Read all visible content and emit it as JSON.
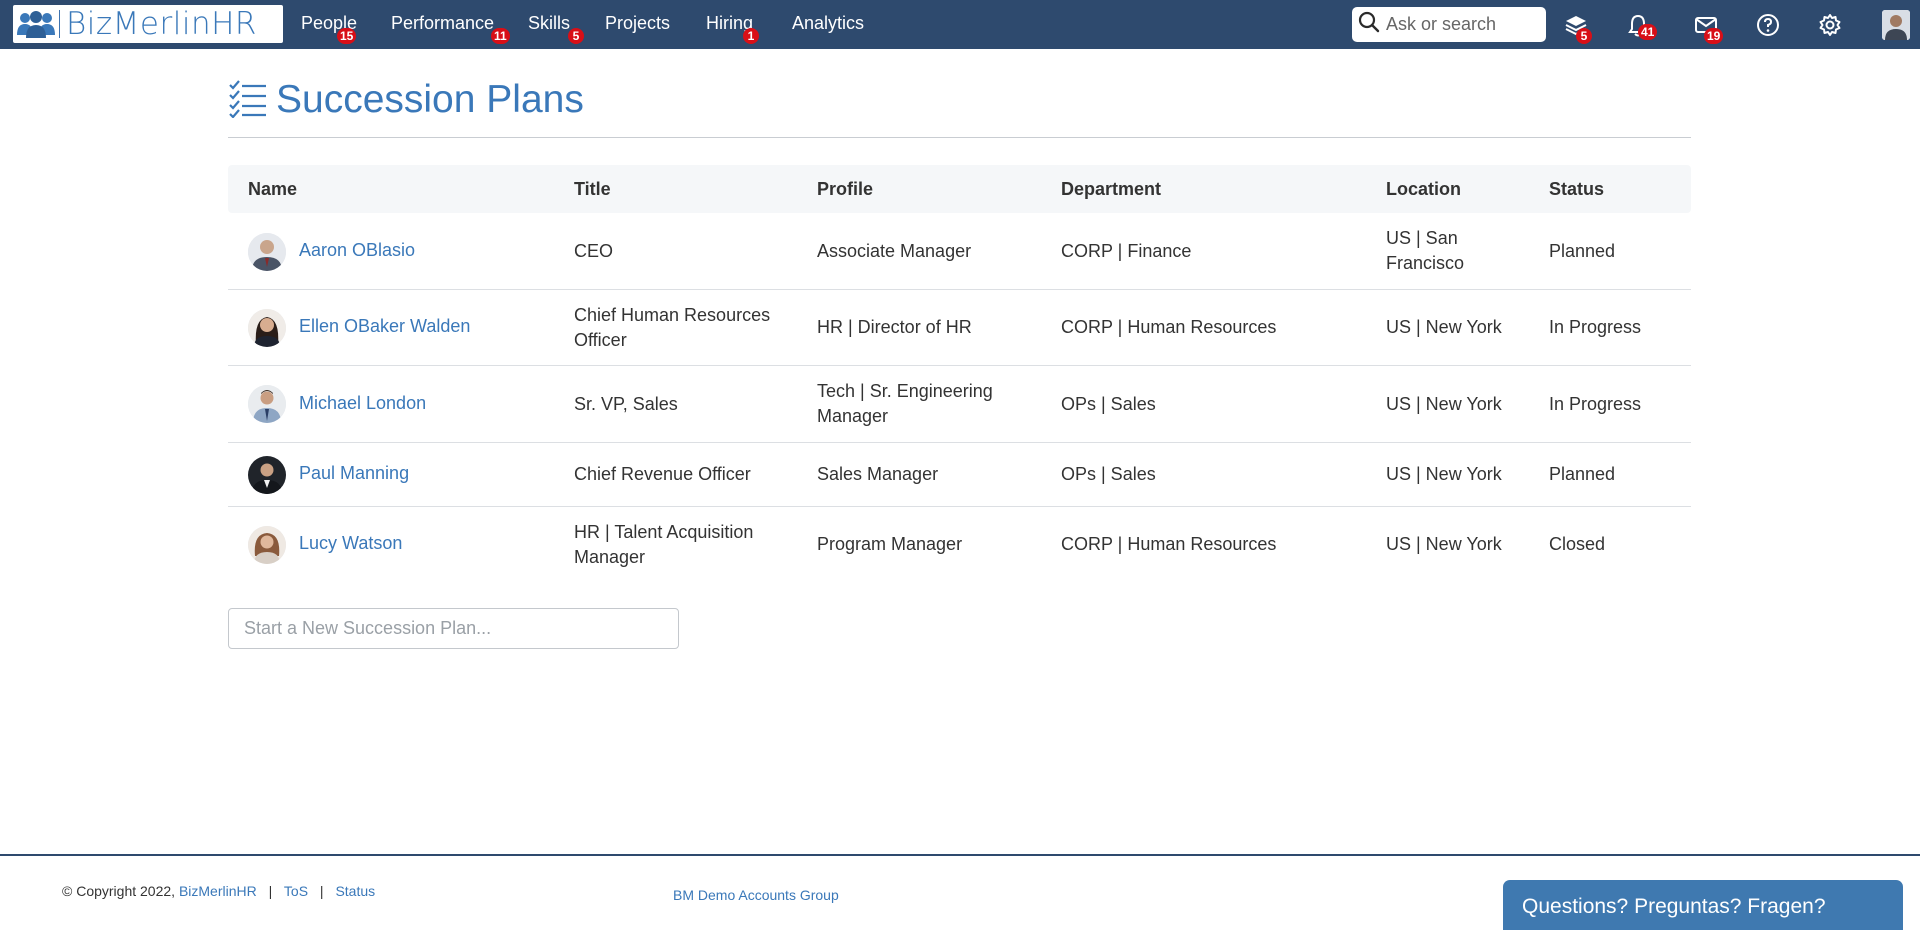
{
  "app": {
    "logo_text": "BizMerlinHR",
    "accent": "#3a78b9",
    "nav_bg": "#2e4a6e",
    "badge_color": "#d80f17"
  },
  "nav": {
    "items": [
      {
        "label": "People",
        "badge": "15"
      },
      {
        "label": "Performance",
        "badge": "11"
      },
      {
        "label": "Skills",
        "badge": "5"
      },
      {
        "label": "Projects",
        "badge": ""
      },
      {
        "label": "Hiring",
        "badge": "1"
      },
      {
        "label": "Analytics",
        "badge": ""
      }
    ],
    "search_placeholder": "Ask or search",
    "icons": [
      {
        "name": "layers-icon",
        "badge": "5"
      },
      {
        "name": "bell-icon",
        "badge": "41"
      },
      {
        "name": "mail-icon",
        "badge": "19"
      },
      {
        "name": "help-icon",
        "badge": ""
      },
      {
        "name": "gear-icon",
        "badge": ""
      },
      {
        "name": "user-avatar",
        "badge": ""
      }
    ]
  },
  "page": {
    "title": "Succession Plans",
    "title_icon": "checklist-icon"
  },
  "table": {
    "columns": [
      "Name",
      "Title",
      "Profile",
      "Department",
      "Location",
      "Status"
    ],
    "rows": [
      {
        "name": "Aaron OBlasio",
        "title": "CEO",
        "profile": "Associate Manager",
        "department": "CORP | Finance",
        "location": "US | San Francisco",
        "status": "Planned"
      },
      {
        "name": "Ellen OBaker Walden",
        "title": "Chief Human Resources Officer",
        "profile": "HR | Director of HR",
        "department": "CORP | Human Resources",
        "location": "US | New York",
        "status": "In Progress"
      },
      {
        "name": "Michael London",
        "title": "Sr. VP, Sales",
        "profile": "Tech | Sr. Engineering Manager",
        "department": "OPs | Sales",
        "location": "US | New York",
        "status": "In Progress"
      },
      {
        "name": "Paul Manning",
        "title": "Chief Revenue Officer",
        "profile": "Sales Manager",
        "department": "OPs | Sales",
        "location": "US | New York",
        "status": "Planned"
      },
      {
        "name": "Lucy Watson",
        "title": "HR | Talent Acquisition Manager",
        "profile": "Program Manager",
        "department": "CORP | Human Resources",
        "location": "US | New York",
        "status": "Closed"
      }
    ]
  },
  "new_plan": {
    "placeholder": "Start a New Succession Plan..."
  },
  "footer": {
    "copyright": "© Copyright 2022,",
    "brand_link": "BizMerlinHR",
    "sep": "|",
    "tos": "ToS",
    "status": "Status",
    "group": "BM Demo Accounts Group",
    "help": "Questions? Preguntas? Fragen?"
  }
}
